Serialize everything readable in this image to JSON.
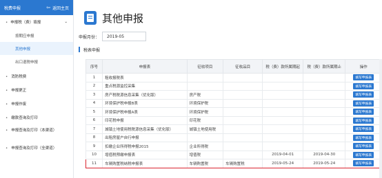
{
  "sidebar": {
    "header_title": "税费申报",
    "back_label": "返回主页",
    "group_label": "申报税（费）填报",
    "sub_items": [
      "按期应申报",
      "其他申报",
      "出口退税申报"
    ],
    "items": [
      "消防税费",
      "申报更正",
      "申报作废",
      "缴款查询及打印",
      "申报查询及打印（本渠道）",
      "申报查询及打印（全渠道）"
    ]
  },
  "main": {
    "title": "其他申报",
    "period_label": "申报月份：",
    "period_value": "2019-05",
    "section_title": "税表申报",
    "columns": [
      "序号",
      "申报表",
      "征收项目",
      "征收品目",
      "税（费）款所属期起",
      "税（费）款所属期止",
      "操作"
    ],
    "rows": [
      [
        "1",
        "租收报税表",
        "",
        "",
        "",
        "",
        "填写申报表"
      ],
      [
        "2",
        "重点税源监控采集",
        "",
        "",
        "",
        "",
        "填写申报表"
      ],
      [
        "3",
        "房产税税源信息采集（优化版）",
        "房产税",
        "",
        "",
        "",
        "填写申报表"
      ],
      [
        "4",
        "环境保护税申报B表",
        "环境保护税",
        "",
        "",
        "",
        "填写申报表"
      ],
      [
        "5",
        "环境保护税申报A表",
        "环境保护税",
        "",
        "",
        "",
        "填写申报表"
      ],
      [
        "6",
        "印花税申报",
        "印花税",
        "",
        "",
        "",
        "填写申报表"
      ],
      [
        "7",
        "城镇土地使用税税源信息采集（优化版）",
        "城镇土地使用税",
        "",
        "",
        "",
        "填写申报表"
      ],
      [
        "8",
        "出租房屋户自行申报",
        "",
        "",
        "",
        "",
        "填写申报表"
      ],
      [
        "9",
        "扣缴企业所得税申报2015",
        "企业所得税",
        "",
        "",
        "",
        "填写申报表"
      ],
      [
        "10",
        "增值税预缴申报表",
        "增值税",
        "",
        "2019-04-01",
        "2019-04-30",
        "填写申报表"
      ],
      [
        "11",
        "车辆购置税纳税申报表",
        "车辆购置税",
        "车辆购置税",
        "2019-05-24",
        "2019-05-24",
        "填写申报表"
      ]
    ],
    "highlight_row": 10
  }
}
